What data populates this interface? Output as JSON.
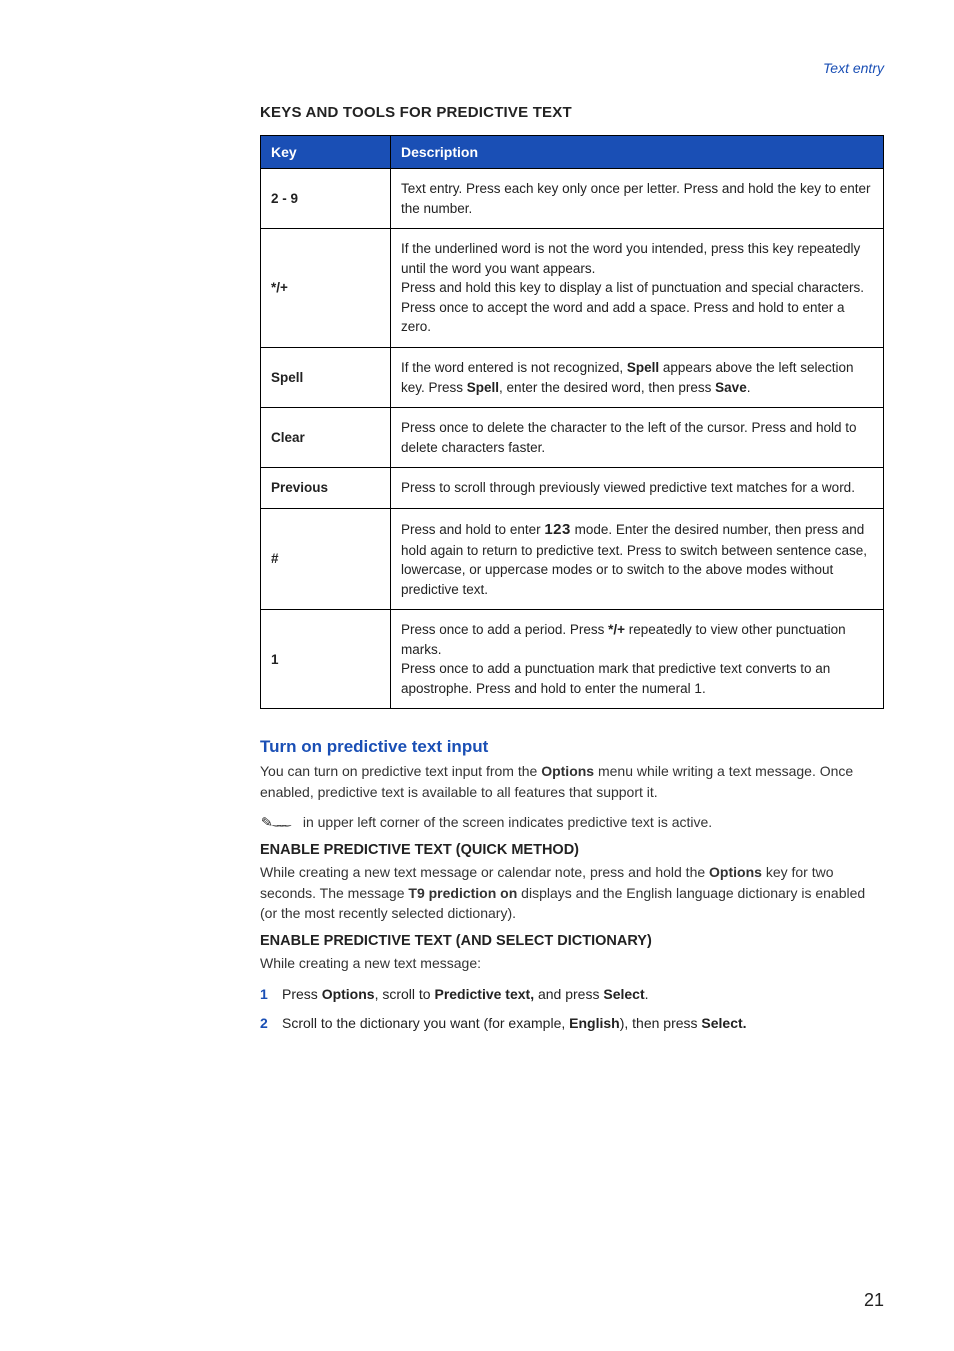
{
  "breadcrumb": "Text entry",
  "section_title": "KEYS AND TOOLS FOR PREDICTIVE TEXT",
  "table": {
    "head": {
      "key": "Key",
      "desc": "Description"
    },
    "rows": [
      {
        "key": "2 - 9",
        "desc": "Text entry. Press each key only once per letter. Press and hold the key to enter the number."
      },
      {
        "key": "*/+",
        "desc_parts": {
          "a": "If the underlined word is not the word you intended, press this key repeatedly until the word you want appears.",
          "b": "Press and hold this key to display a list of punctuation and special characters.",
          "c": "Press once to accept the word and add a space. Press and hold to enter a zero."
        }
      },
      {
        "key": "Spell",
        "pre": "If the word entered is not recognized, ",
        "b1": "Spell",
        "mid": " appears above the left selection key. Press ",
        "b2": "Spell",
        "mid2": ", enter the desired word, then press ",
        "b3": "Save",
        "post": "."
      },
      {
        "key": "Clear",
        "desc": "Press once to delete the character to the left of the cursor. Press and hold to delete characters faster."
      },
      {
        "key": "Previous",
        "desc": "Press to scroll through previously viewed predictive text matches for a word."
      },
      {
        "key": "#",
        "pre": "Press and hold to enter ",
        "mode": "123",
        "post": " mode. Enter the desired number, then press and hold again to return to predictive text. Press to switch between sentence case, lowercase, or uppercase modes or to switch to the above modes without predictive text."
      },
      {
        "key": "1",
        "a_pre": "Press once to add a period. Press ",
        "a_bold": "*/+",
        "a_post": " repeatedly to view other punctuation marks.",
        "b": "Press once to add a punctuation mark that predictive text converts to an apostrophe. Press and hold to enter the numeral 1."
      }
    ]
  },
  "h_turn_on": "Turn on predictive text input",
  "turn_on": {
    "pre": "You can turn on predictive text input from the ",
    "b1": "Options",
    "post": " menu while writing a text message. Once enabled, predictive text is available to all features that support it."
  },
  "icon_caption": " in upper left corner of the screen indicates predictive text is active.",
  "sub_quick": "ENABLE PREDICTIVE TEXT (QUICK METHOD)",
  "quick": {
    "pre": "While creating a new text message or calendar note, press and hold the ",
    "b1": "Options",
    "mid1": " key for two seconds. The message ",
    "b2": "T9 prediction on",
    "post": " displays and the English language dictionary is enabled (or the most recently selected dictionary)."
  },
  "sub_dict": "ENABLE PREDICTIVE TEXT (AND SELECT DICTIONARY)",
  "dict_intro": "While creating a new text message:",
  "steps": {
    "s1": {
      "pre": "Press ",
      "b1": "Options",
      "mid1": ", scroll to ",
      "b2": "Predictive text,",
      "mid2": " and press ",
      "b3": "Select",
      "post": "."
    },
    "s2": {
      "pre": "Scroll to the dictionary you want (for example, ",
      "b1": "English",
      "mid1": "), then press ",
      "b2": "Select.",
      "post": ""
    }
  },
  "page_number": "21"
}
